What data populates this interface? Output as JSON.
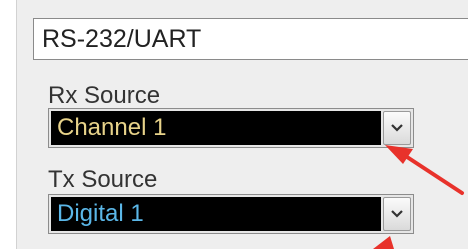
{
  "protocol": {
    "value": "RS-232/UART"
  },
  "rx_source": {
    "label": "Rx Source",
    "selected": "Channel 1",
    "text_color": "#e8d38a"
  },
  "tx_source": {
    "label": "Tx Source",
    "selected": "Digital 1",
    "text_color": "#5bb7e8"
  },
  "icons": {
    "dropdown_arrow": "chevron-down-icon",
    "annotation": "red-arrow-icon"
  },
  "colors": {
    "annotation_arrow": "#e8322b",
    "dropdown_background": "#000000",
    "panel_background": "#eeeeee"
  }
}
